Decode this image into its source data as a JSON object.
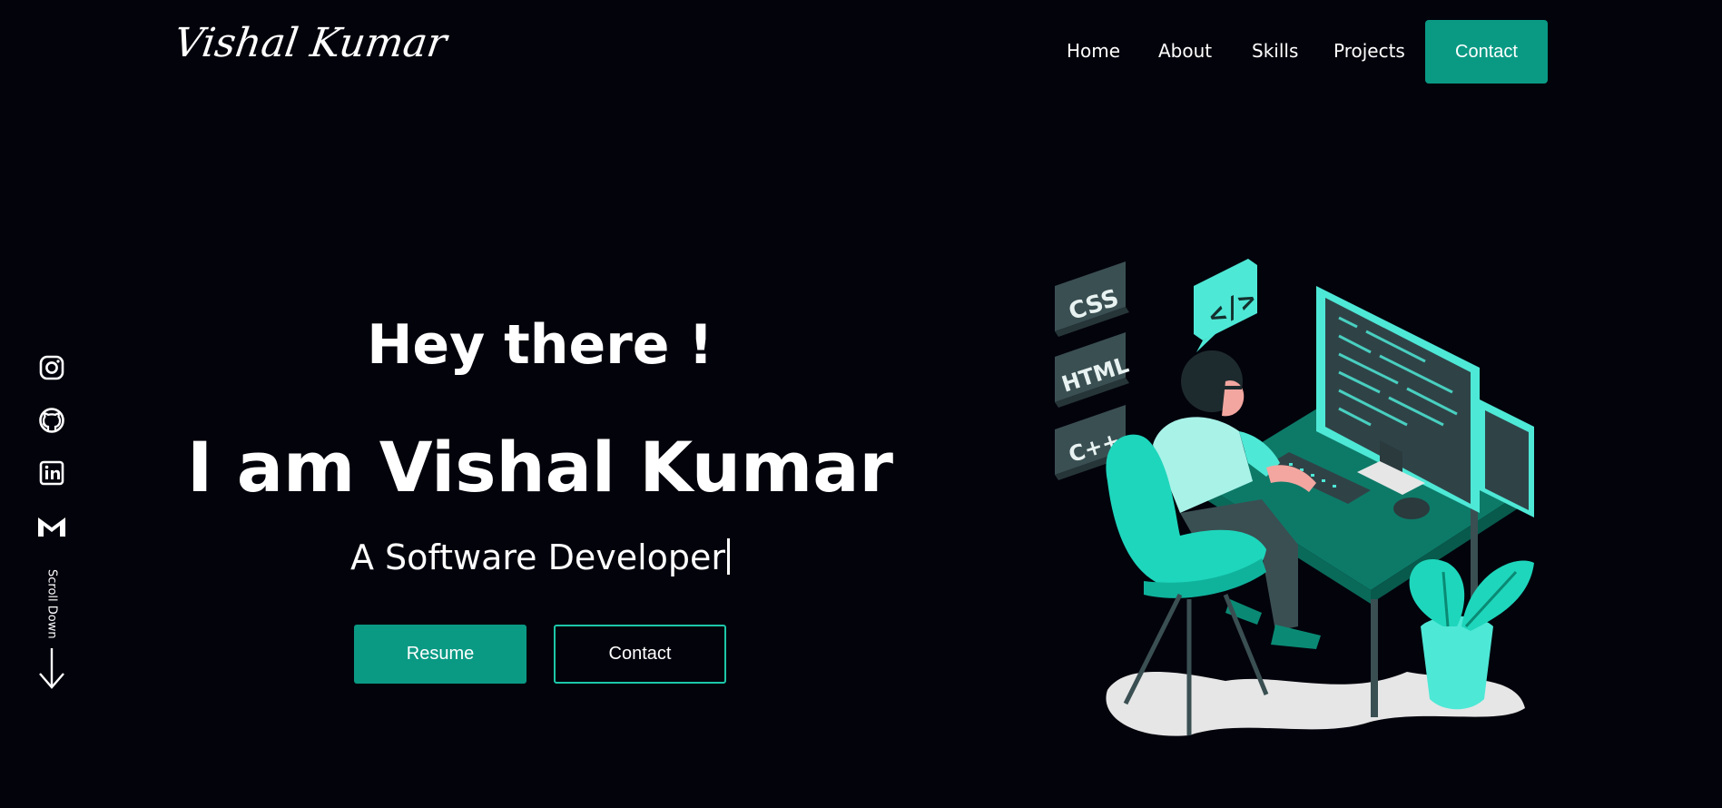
{
  "header": {
    "logo": "Vishal Kumar",
    "nav": [
      {
        "label": "Home"
      },
      {
        "label": "About"
      },
      {
        "label": "Skills"
      },
      {
        "label": "Projects"
      }
    ],
    "contact_label": "Contact"
  },
  "social": {
    "icons": [
      "instagram-icon",
      "github-icon",
      "linkedin-icon",
      "gmail-icon"
    ],
    "scroll_label": "Scroll Down"
  },
  "hero": {
    "greeting": "Hey there !",
    "name": "I am Vishal Kumar",
    "role": "A Software Developer",
    "resume_label": "Resume",
    "contact_label": "Contact"
  },
  "illustration": {
    "tags": [
      "CSS",
      "HTML",
      "C++"
    ],
    "code_bubble": "</>"
  },
  "colors": {
    "background": "#03030c",
    "accent": "#0a9a84",
    "accent_light": "#1cc7a8",
    "text": "#ffffff"
  }
}
